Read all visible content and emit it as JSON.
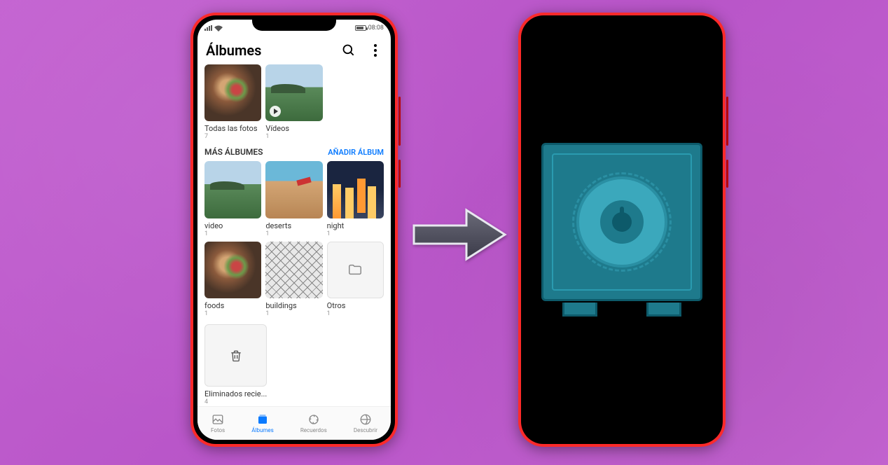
{
  "status": {
    "time": "08:08"
  },
  "header": {
    "title": "Álbumes"
  },
  "top_albums": [
    {
      "label": "Todas las fotos",
      "count": "7",
      "kind": "food"
    },
    {
      "label": "Vídeos",
      "count": "1",
      "kind": "landscape",
      "play": true
    }
  ],
  "section": {
    "title": "MÁS ÁLBUMES",
    "add": "AÑADIR ÁLBUM"
  },
  "more_albums": [
    {
      "label": "video",
      "count": "1",
      "kind": "landscape"
    },
    {
      "label": "deserts",
      "count": "1",
      "kind": "desert"
    },
    {
      "label": "night",
      "count": "1",
      "kind": "night"
    },
    {
      "label": "foods",
      "count": "1",
      "kind": "food"
    },
    {
      "label": "buildings",
      "count": "1",
      "kind": "buildings"
    },
    {
      "label": "Otros",
      "count": "1",
      "kind": "placeholder",
      "icon": "folder"
    }
  ],
  "deleted": {
    "label": "Eliminados recie...",
    "count": "4"
  },
  "nav": {
    "fotos": "Fotos",
    "albumes": "Álbumes",
    "recuerdos": "Recuerdos",
    "descubrir": "Descubrir"
  }
}
